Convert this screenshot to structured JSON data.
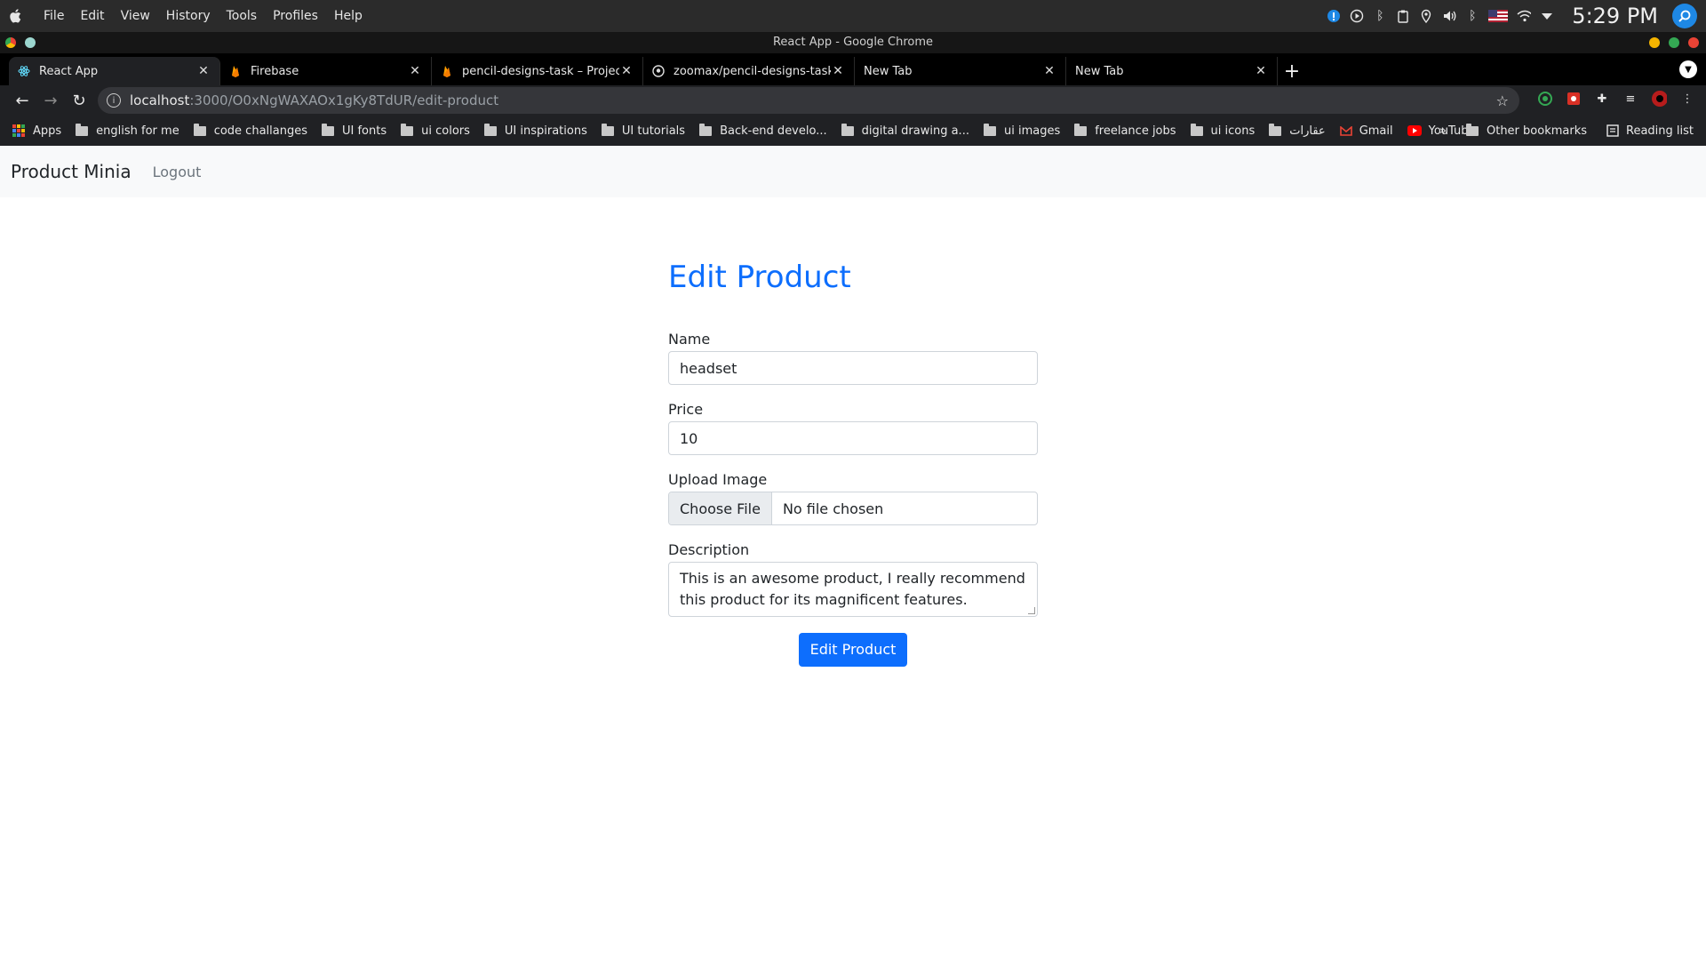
{
  "os": {
    "menus": [
      "File",
      "Edit",
      "View",
      "History",
      "Tools",
      "Profiles",
      "Help"
    ],
    "clock": "5:29 PM"
  },
  "window": {
    "title": "React App - Google Chrome"
  },
  "tabs": [
    {
      "title": "React App",
      "active": true,
      "favicon": "react-icon"
    },
    {
      "title": "Firebase",
      "active": false,
      "favicon": "firebase-icon"
    },
    {
      "title": "pencil-designs-task – Project",
      "active": false,
      "favicon": "firebase-icon"
    },
    {
      "title": "zoomax/pencil-designs-task",
      "active": false,
      "favicon": "github-icon"
    },
    {
      "title": "New Tab",
      "active": false,
      "favicon": ""
    },
    {
      "title": "New Tab",
      "active": false,
      "favicon": ""
    }
  ],
  "address": {
    "host": "localhost",
    "path": ":3000/O0xNgWAXAOx1gKy8TdUR/edit-product"
  },
  "bookmarks": {
    "apps": "Apps",
    "items": [
      "english for me",
      "code challanges",
      "UI fonts",
      "ui colors",
      "UI inspirations",
      "UI tutorials",
      "Back-end develo...",
      "digital drawing a...",
      "ui images",
      "freelance jobs",
      "ui icons",
      "عقارات"
    ],
    "gmail": "Gmail",
    "youtube": "YouTube",
    "overflow": "»",
    "other": "Other bookmarks",
    "reading": "Reading list"
  },
  "app": {
    "brand": "Product Minia",
    "logout": "Logout"
  },
  "form": {
    "heading": "Edit Product",
    "name_label": "Name",
    "name_value": "headset",
    "price_label": "Price",
    "price_value": "10",
    "image_label": "Upload Image",
    "choose_file": "Choose File",
    "no_file": "No file chosen",
    "description_label": "Description",
    "description_value": "This is an awesome product, I really recommend this product for its magnificent features.",
    "submit": "Edit Product"
  },
  "colors": {
    "primary": "#0d6efd",
    "navbar_bg": "#f8f9fa",
    "chrome_bg": "#202124"
  }
}
